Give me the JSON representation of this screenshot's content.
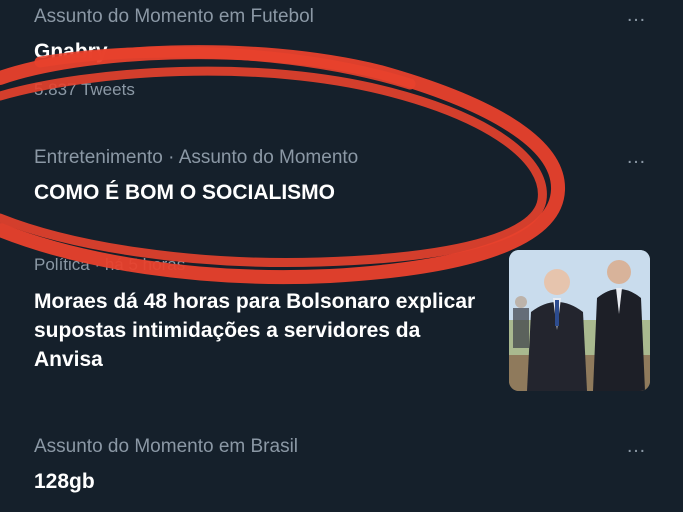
{
  "trends": [
    {
      "context": "Assunto do Momento em Futebol",
      "title": "Gnabry",
      "count": "5.837 Tweets"
    },
    {
      "context": "Entretenimento · Assunto do Momento",
      "title": "COMO É BOM O SOCIALISMO"
    },
    {
      "context": "Assunto do Momento em Brasil",
      "title": "128gb"
    }
  ],
  "news": {
    "meta": "Política · há 5 horas",
    "title": "Moraes dá 48 horas para Bolsonaro explicar supostas intimidações a servidores da Anvisa"
  },
  "more_icon": "…",
  "colors": {
    "background": "#15202b",
    "secondary_text": "#8b98a5",
    "primary_text": "#ffffff",
    "annotation": "#e8412c"
  }
}
